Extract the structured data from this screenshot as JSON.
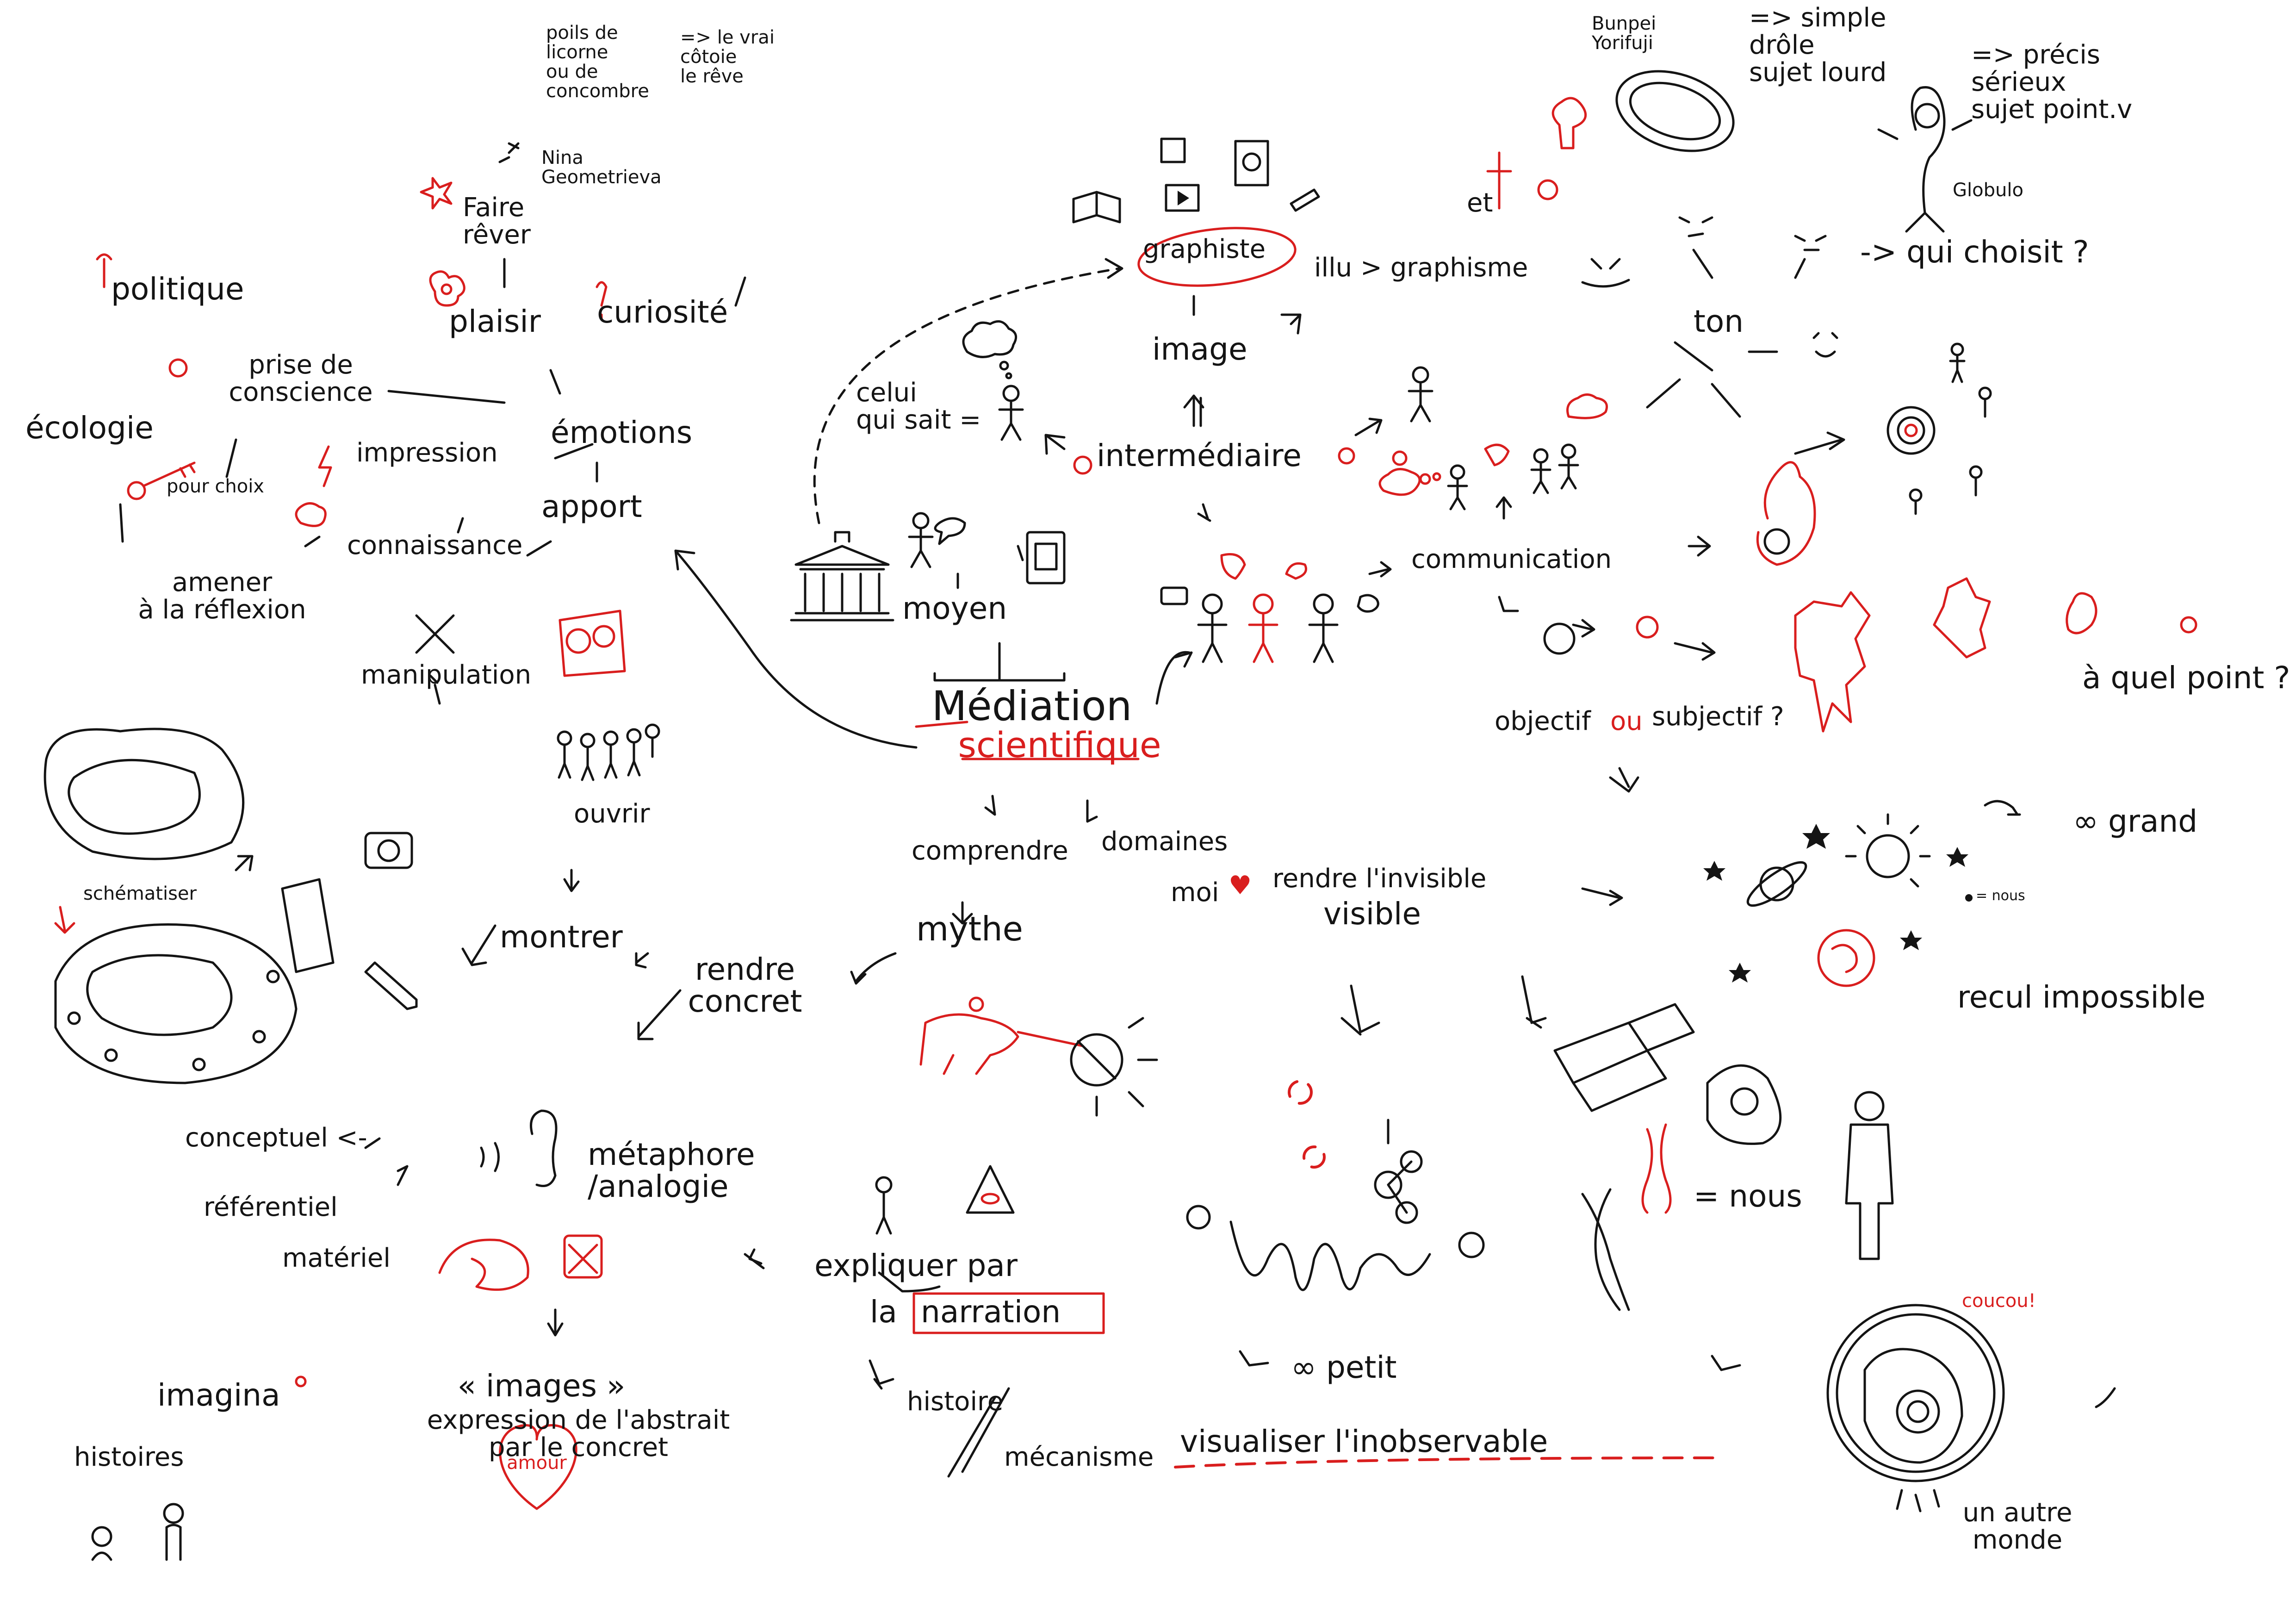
{
  "title": {
    "line1": "Médiation",
    "line2": "scientifique"
  },
  "left": {
    "faire_rever": "Faire\nrêver",
    "poils": "poils de\nlicorne\nou de\nconcombre",
    "reve": "=> le vrai\ncôtoie\nle rêve",
    "nina": "Nina\nGeometrieva",
    "plaisir": "plaisir",
    "curiosite": "curiosité",
    "politique": "politique",
    "prise": "prise de\nconscience",
    "ecologie": "écologie",
    "pour_choix": "pour choix",
    "impression": "impression",
    "emotions": "émotions",
    "apport": "apport",
    "connaissance": "connaissance",
    "amener": "amener\nà la réflexion",
    "manipulation": "manipulation",
    "ouvrir": "ouvrir",
    "schematiser": "schématiser",
    "montrer": "montrer",
    "rendre_concret": "rendre\nconcret",
    "conceptuel": "conceptuel <-",
    "referentiel": "référentiel",
    "materiel": "matériel",
    "metaphore": "métaphore\n/analogie",
    "images": "« images »",
    "expression": "expression de l'abstrait\npar le concret",
    "imagina": "imagina",
    "histoires": "histoires",
    "amour": "amour",
    "expliquer": "expliquer par",
    "la": "la",
    "narration": "narration",
    "histoire": "histoire",
    "mecanisme": "mécanisme"
  },
  "center": {
    "graphiste": "graphiste",
    "illu": "illu > graphisme",
    "image": "image",
    "celui": "celui\nqui sait =",
    "intermediaire": "intermédiaire",
    "moyen": "moyen",
    "communication": "communication",
    "objectif": "objectif",
    "ou": "ou",
    "subjectif": "subjectif ?",
    "comprendre": "comprendre",
    "domaines": "domaines",
    "moi": "moi",
    "rendre_invisible": "rendre l'invisible",
    "visible": "visible",
    "mythe": "mythe",
    "infini_petit": "∞ petit",
    "visualiser": "visualiser l'inobservable"
  },
  "right": {
    "bunpei": "Bunpei\nYorifuji",
    "simple": "=> simple\ndrôle\nsujet lourd",
    "precis": "=> précis\nsérieux\nsujet point.v",
    "globulo": "Globulo",
    "et": "et",
    "ton": "ton",
    "qui_choisit": "-> qui choisit ?",
    "a_quel_point": "à quel point ?",
    "infini_grand": "∞ grand",
    "nous_small": "= nous",
    "recul": "recul impossible",
    "egal_nous": "= nous",
    "coucou": "coucou!",
    "autre_monde": "un autre\nmonde"
  },
  "colors": {
    "ink": "#141414",
    "accent": "#d91e1e",
    "paper": "#ffffff"
  },
  "icons": [
    "museum-icon",
    "book-icon",
    "speech-bubble-icon",
    "stick-figure-icon",
    "thought-cloud-icon",
    "flower-icon",
    "question-mark-icon",
    "key-icon",
    "lightning-icon",
    "eye-triangle-icon",
    "ear-icon",
    "wave-icon",
    "drum-icon",
    "heart-icon",
    "camera-icon",
    "pencil-icon",
    "sun-icon",
    "galaxy-icon",
    "planet-icon",
    "molecule-icon",
    "dna-icon",
    "chromosome-icon",
    "cell-icon",
    "human-silhouette-icon",
    "tardigrade-icon",
    "unicorn-rider-icon",
    "ring-icon",
    "monster-icon"
  ]
}
